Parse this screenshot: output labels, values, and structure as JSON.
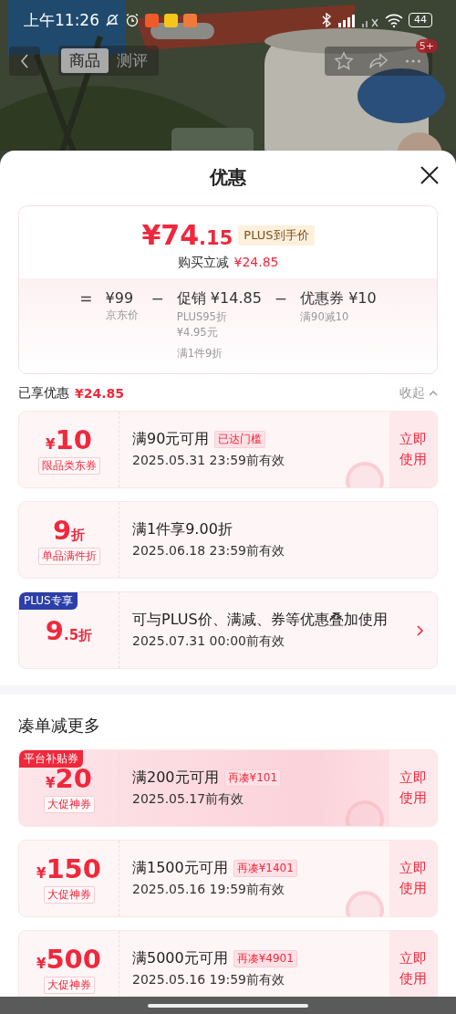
{
  "status_bar": {
    "time": "上午11:26",
    "battery": "44"
  },
  "nav": {
    "tabs": [
      {
        "label": "商品",
        "selected": true
      },
      {
        "label": "测评",
        "selected": false
      }
    ],
    "badge": "5+"
  },
  "sheet": {
    "title": "优惠"
  },
  "price_card": {
    "currency": "¥",
    "integer": "74",
    "decimal": ".15",
    "tag": "PLUS到手价",
    "reduce_label": "购买立减",
    "reduce_amount": "¥24.85",
    "breakdown": [
      {
        "op": "=",
        "amount": "¥99",
        "notes": [
          "京东价"
        ]
      },
      {
        "op": "−",
        "amount": "促销 ¥14.85",
        "notes": [
          "PLUS95折",
          "¥4.95元",
          "满1件9折"
        ]
      },
      {
        "op": "−",
        "amount": "优惠券 ¥10",
        "notes": [
          "满90减10"
        ]
      }
    ]
  },
  "enjoyed": {
    "label": "已享优惠",
    "amount": "¥24.85",
    "toggle": "收起"
  },
  "coupons": [
    {
      "kind": "action",
      "currency": "¥",
      "amount": "10",
      "type": "限品类东券",
      "title": "满90元可用",
      "status": "已达门槛",
      "validity": "2025.05.31 23:59前有效",
      "action": "立即使用",
      "claimed": true
    },
    {
      "kind": "plain",
      "amount": "9",
      "suffix": "折",
      "type": "单品满件折",
      "title": "满1件享9.00折",
      "validity": "2025.06.18 23:59前有效",
      "claimed": false
    },
    {
      "kind": "arrow",
      "badge": {
        "text": "PLUS专享",
        "color": "#2b3fa8"
      },
      "amount": "9",
      "suffix": ".5折",
      "title": "可与PLUS价、满减、券等优惠叠加使用",
      "validity": "2025.07.31 00:00前有效",
      "claimed": false
    }
  ],
  "more_section": {
    "title": "凑单减更多",
    "coupons": [
      {
        "kind": "action",
        "badge": {
          "text": "平台补贴券",
          "color": "#f0283c"
        },
        "currency": "¥",
        "amount": "20",
        "type": "大促神券",
        "title": "满200元可用",
        "status": "再凑¥101",
        "validity": "2025.05.17前有效",
        "action": "立即使用",
        "claimed": true,
        "highlight": true
      },
      {
        "kind": "action",
        "currency": "¥",
        "amount": "150",
        "type": "大促神券",
        "title": "满1500元可用",
        "status": "再凑¥1401",
        "validity": "2025.05.16 19:59前有效",
        "action": "立即使用",
        "claimed": true
      },
      {
        "kind": "action",
        "currency": "¥",
        "amount": "500",
        "type": "大促神券",
        "title": "满5000元可用",
        "status": "再凑¥4901",
        "validity": "2025.05.16 19:59前有效",
        "action": "立即使用",
        "claimed": false
      }
    ]
  }
}
